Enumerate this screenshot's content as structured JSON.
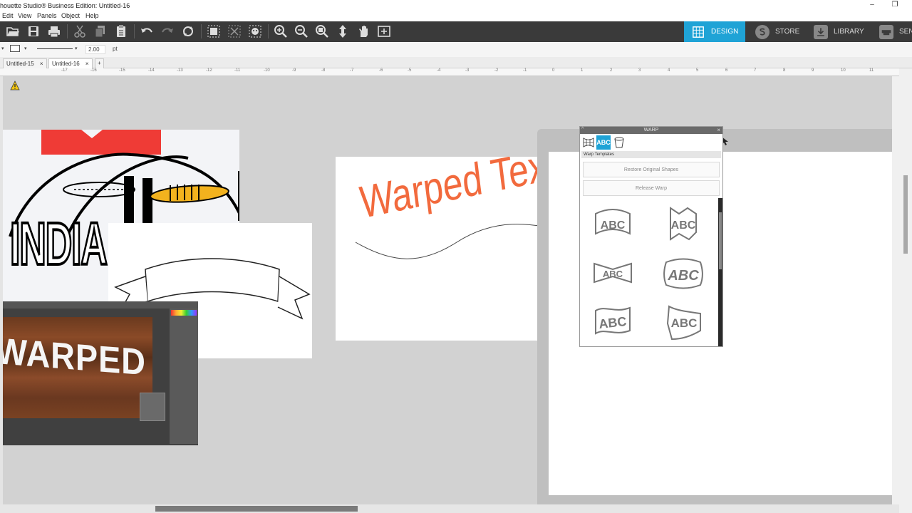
{
  "window": {
    "title": "houette Studio® Business Edition: Untitled-16",
    "minimize": "–",
    "restore": "❐"
  },
  "menu": [
    "Edit",
    "View",
    "Panels",
    "Object",
    "Help"
  ],
  "toolbar": {
    "icons": [
      "folder-open",
      "save",
      "print",
      "cut",
      "copy",
      "paste",
      "undo",
      "redo",
      "replicate",
      "group",
      "ungroup",
      "trace",
      "zoom-in",
      "zoom-out",
      "zoom-select",
      "move",
      "pan",
      "fit"
    ]
  },
  "nav_tabs": [
    {
      "label": "DESIGN",
      "active": true
    },
    {
      "label": "STORE",
      "active": false
    },
    {
      "label": "LIBRARY",
      "active": false
    },
    {
      "label": "SEN",
      "active": false
    }
  ],
  "line_options": {
    "width_value": "2.00",
    "unit": "pt"
  },
  "doc_tabs": [
    "Untitled-15",
    "Untitled-16"
  ],
  "ruler_labels": [
    "-17",
    "-16",
    "-15",
    "-14",
    "-13",
    "-12",
    "-11",
    "-10",
    "-9",
    "-8",
    "-7",
    "-6",
    "-5",
    "-4",
    "-3",
    "-2",
    "-1",
    "0",
    "1",
    "2",
    "3",
    "4",
    "5",
    "6",
    "7",
    "8",
    "9",
    "10",
    "11"
  ],
  "canvas_items": {
    "football_text": "INDIA",
    "warped_text": "Warped Text",
    "wood_text": "WARPED"
  },
  "warp_panel": {
    "title": "WARP",
    "section": "Warp Templates",
    "restore_button": "Restore Original Shapes",
    "release_button": "Release Warp",
    "template_text": "ABC"
  },
  "colors": {
    "accent": "#1fa3d6",
    "warp_text": "#f26a3d",
    "banner_red": "#ef3b36",
    "toolbar_bg": "#3a3a3a"
  }
}
